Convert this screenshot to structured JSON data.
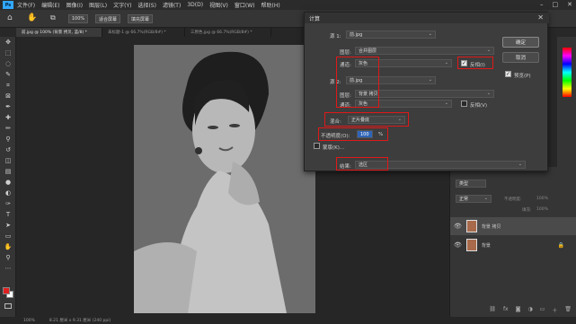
{
  "menubar": {
    "logo": "Ps",
    "items": [
      "文件(F)",
      "编辑(E)",
      "图像(I)",
      "图层(L)",
      "文字(Y)",
      "选择(S)",
      "滤镜(T)",
      "3D(D)",
      "视图(V)",
      "窗口(W)",
      "帮助(H)"
    ]
  },
  "optionsbar": {
    "zoom_value": "100%",
    "fit_screen": "适合屏幕",
    "fill_screen": "填充屏幕"
  },
  "tabs": [
    {
      "label": "前.jpg @ 100% (背景 拷贝, 蓝/8) *",
      "active": true
    },
    {
      "label": "未标题-1 @ 66.7%(RGB/8#) *",
      "active": false
    },
    {
      "label": "三原色.jpg @ 66.7%(RGB/8#) *",
      "active": false
    }
  ],
  "status": {
    "zoom": "100%",
    "info": "8.21 厘米 x 9.31 厘米 (240 ppi)"
  },
  "dialog": {
    "title": "计算",
    "source1_label": "源 1:",
    "source1_value": "前.jpg",
    "layer1_label": "图层:",
    "layer1_value": "合并图层",
    "channel1_label": "通道:",
    "channel1_value": "灰色",
    "invert1_label": "反相(I)",
    "source2_label": "源 2:",
    "source2_value": "前.jpg",
    "layer2_label": "图层:",
    "layer2_value": "背景 拷贝",
    "channel2_label": "通道:",
    "channel2_value": "灰色",
    "invert2_label": "反相(V)",
    "blend_label": "混合:",
    "blend_value": "正片叠底",
    "opacity_label": "不透明度(O):",
    "opacity_value": "100",
    "opacity_unit": "%",
    "mask_label": "蒙版(K)...",
    "result_label": "结果:",
    "result_value": "选区",
    "ok_button": "确定",
    "cancel_button": "取消",
    "preview_label": "预览(P)"
  },
  "layers_panel": {
    "kind_label": "类型",
    "mode_value": "正常",
    "opacity_label": "不透明度:",
    "opacity_value": "100%",
    "fill_label": "填充:",
    "fill_value": "100%",
    "layers": [
      {
        "name": "背景 拷贝",
        "selected": true,
        "locked": false
      },
      {
        "name": "背景",
        "selected": false,
        "locked": true
      }
    ]
  },
  "colors": {
    "foreground": "#e02020",
    "background": "#ffffff",
    "highlight_box": "#e01818"
  }
}
